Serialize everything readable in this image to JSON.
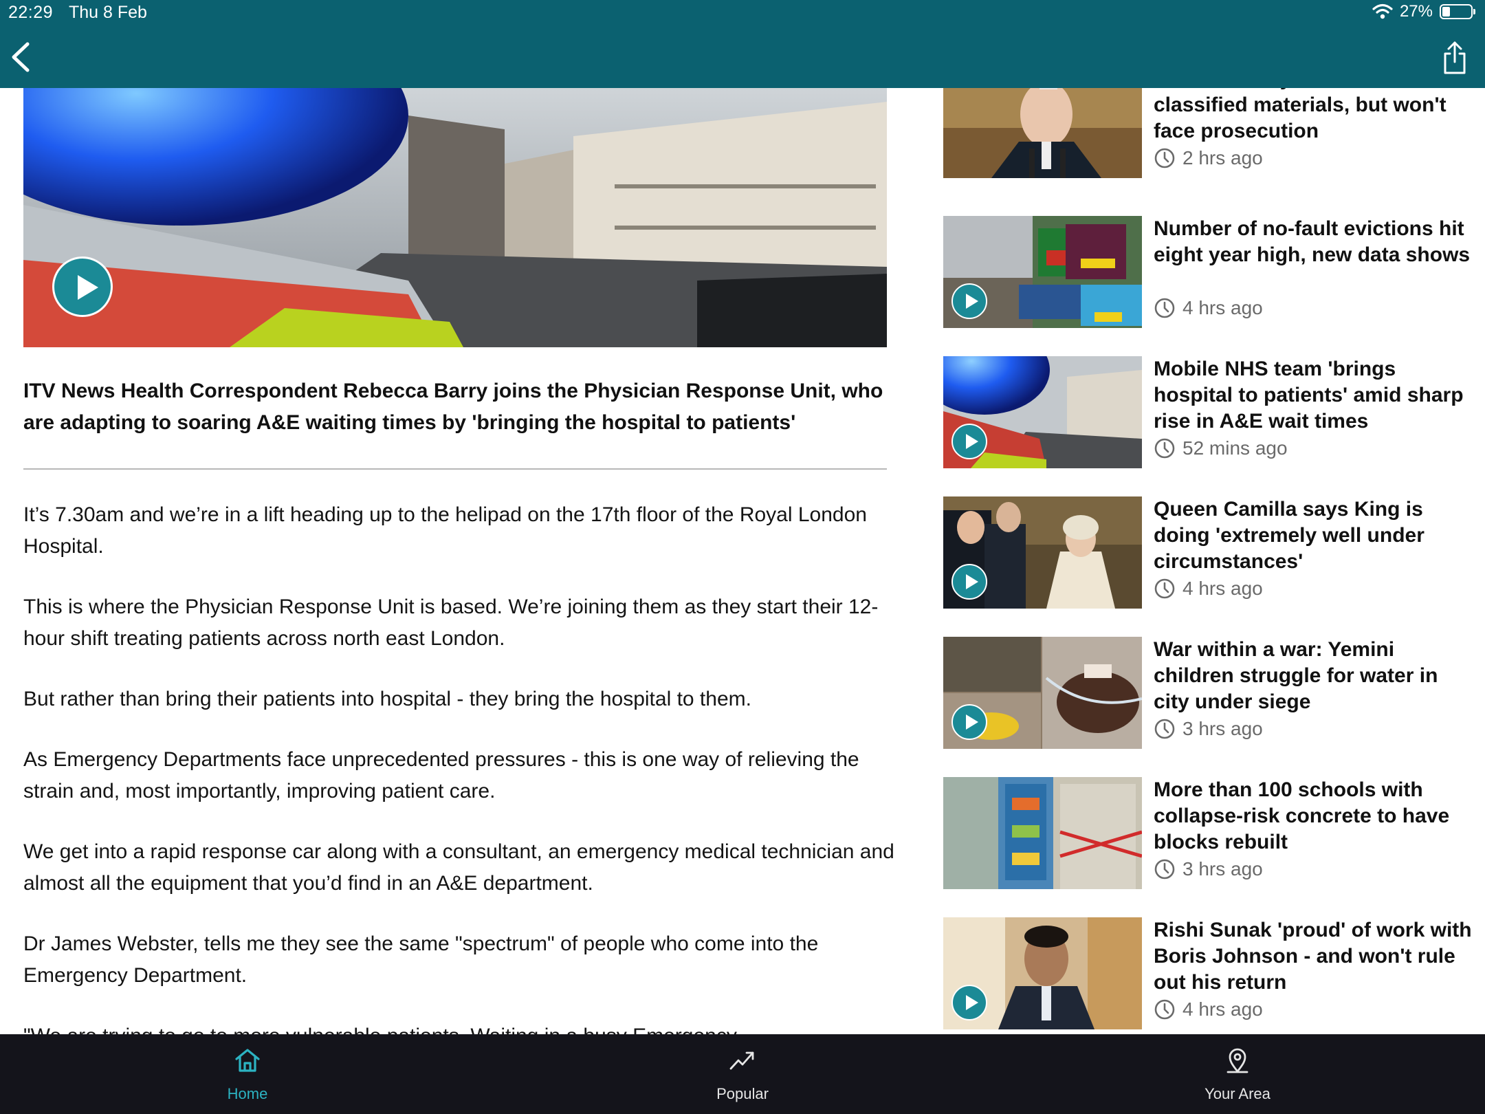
{
  "status_bar": {
    "time": "22:29",
    "date": "Thu 8 Feb",
    "battery_label": "27%",
    "battery_level": 0.27
  },
  "nav": {
    "back_icon": "chevron-left-icon",
    "share_icon": "share-icon"
  },
  "article": {
    "caption": "ITV News Health Correspondent Rebecca Barry joins the Physician Response Unit, who are adapting to soaring A&E waiting times by 'bringing the hospital to patients'",
    "paragraphs": [
      "It’s 7.30am and we’re in a lift heading up to the helipad on the 17th floor of the Royal London Hospital.",
      "This is where the Physician Response Unit is based. We’re joining them as they start their 12-hour shift treating patients across north east London.",
      "But rather than bring their patients into hospital - they bring the hospital to them.",
      "As Emergency Departments face unprecedented pressures - this is one way of relieving the strain and, most importantly, improving patient care.",
      "We get into a rapid response car along with a consultant, an emergency medical technician and almost all the equipment that you’d find in an A&E department.",
      "Dr James Webster, tells me they see the same \"spectrum\" of people who come into the Emergency Department.",
      "\"We are trying to go to more vulnerable patients. Waiting in a busy Emergency"
    ]
  },
  "sidebar": {
    "stories": [
      {
        "title": "Biden 'wilfully' disclosed classified materials, but won't face prosecution",
        "time": "2 hrs ago",
        "video": false
      },
      {
        "title": "Number of no-fault evictions hit eight year high, new data shows",
        "time": "4 hrs ago",
        "video": true
      },
      {
        "title": "Mobile NHS team 'brings hospital to patients' amid sharp rise in A&E wait times",
        "time": "52 mins ago",
        "video": true
      },
      {
        "title": "Queen Camilla says King is doing 'extremely well under circumstances'",
        "time": "4 hrs ago",
        "video": true
      },
      {
        "title": "War within a war: Yemini children struggle for water in city under siege",
        "time": "3 hrs ago",
        "video": true
      },
      {
        "title": "More than 100 schools with collapse-risk concrete to have blocks rebuilt",
        "time": "3 hrs ago",
        "video": false
      },
      {
        "title": "Rishi Sunak 'proud' of work with Boris Johnson - and won't rule out his return",
        "time": "4 hrs ago",
        "video": true
      }
    ]
  },
  "tabs": [
    {
      "label": "Home",
      "icon": "home-icon",
      "active": true
    },
    {
      "label": "Popular",
      "icon": "trending-icon",
      "active": false
    },
    {
      "label": "Your Area",
      "icon": "location-pin-icon",
      "active": false
    }
  ],
  "colors": {
    "nav_bar": "#0b6170",
    "accent": "#2cb3c2",
    "play_button": "#1b8a96",
    "tab_bar": "#14141b"
  }
}
